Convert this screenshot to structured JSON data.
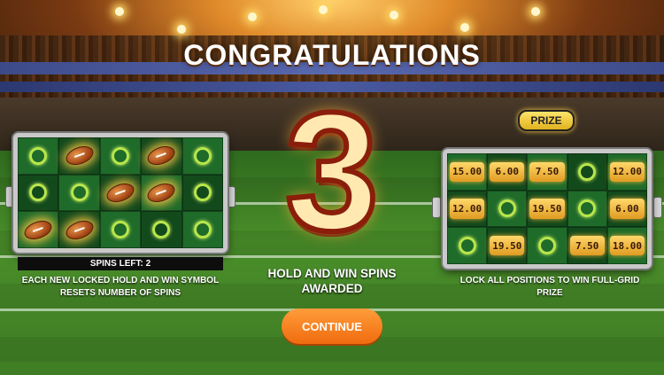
{
  "title": "CONGRATULATIONS",
  "spins_awarded": "3",
  "awarded_text": "HOLD AND WIN SPINS AWARDED",
  "left_panel": {
    "spins_left": "SPINS LEFT: 2",
    "description": "EACH NEW LOCKED HOLD AND WIN SYMBOL RESETS NUMBER OF SPINS",
    "grid": [
      [
        "ring",
        "ball",
        "ring",
        "ball",
        "ring"
      ],
      [
        "ring",
        "ring",
        "ball",
        "ball",
        "ring"
      ],
      [
        "ball",
        "ball",
        "ring",
        "ring",
        "ring"
      ]
    ]
  },
  "right_panel": {
    "badge": "PRIZE",
    "description": "LOCK ALL POSITIONS TO WIN FULL-GRID PRIZE",
    "grid": [
      [
        "15.00",
        "6.00",
        "7.50",
        "ring",
        "12.00"
      ],
      [
        "12.00",
        "ring",
        "19.50",
        "ring",
        "6.00"
      ],
      [
        "ring",
        "19.50",
        "ring",
        "7.50",
        "18.00"
      ]
    ]
  },
  "continue_label": "CONTINUE",
  "colors": {
    "accent_orange": "#f07a1a",
    "ring_green": "#b8e64a",
    "prize_gold": "#f0b530"
  },
  "icons": {
    "ball": "football-icon",
    "ring": "empty-slot-ring-icon"
  }
}
